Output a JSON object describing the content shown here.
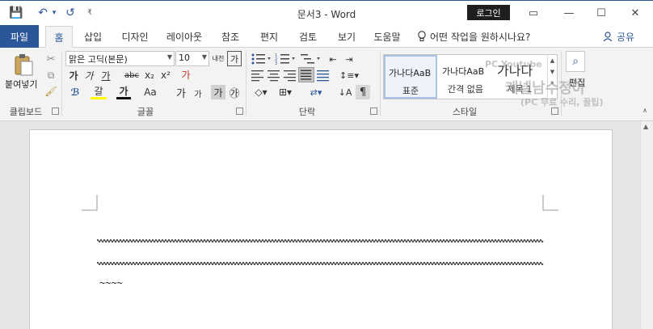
{
  "titlebar": {
    "title": "문서3 - Word",
    "login_label": "로그인",
    "save_icon": "💾",
    "undo_icon": "↶",
    "undo_dropdown": "▾",
    "redo_icon": "↺",
    "customize_icon": "₹",
    "ribbon_options_icon": "▭",
    "minimize_icon": "—",
    "maximize_icon": "☐",
    "close_icon": "✕"
  },
  "tabs": {
    "file": "파일",
    "items": [
      "홈",
      "삽입",
      "디자인",
      "레이아웃",
      "참조",
      "편지",
      "검토",
      "보기",
      "도움말"
    ],
    "tellme": "어떤 작업을 원하시나요?",
    "share": "공유"
  },
  "ribbon": {
    "clipboard": {
      "label": "클립보드",
      "paste": "붙여넣기"
    },
    "font": {
      "label": "글꼴",
      "font_name": "맑은 고딕(본문)",
      "font_size": "10",
      "bold": "가",
      "italic": "가",
      "underline": "가",
      "strike": "abc",
      "subscript": "x₂",
      "superscript": "x²",
      "clear": "가",
      "aa": "Aa",
      "grow": "가",
      "shrink": "가",
      "phonetic": "내천",
      "charborder": "가",
      "highlight": "갈",
      "fontcolor": "가",
      "charshade": "가",
      "enclose": "㉮"
    },
    "paragraph": {
      "label": "단락"
    },
    "styles": {
      "label": "스타일",
      "items": [
        {
          "sample": "가나다AaB",
          "name": "표준"
        },
        {
          "sample": "가나다AaB",
          "name": "간격 없음"
        },
        {
          "sample": "가나다",
          "name": "제목 1"
        }
      ]
    },
    "editing": {
      "label": "편집"
    },
    "watermark": {
      "line1": "PC Youtube",
      "line2": "케넬남수정아",
      "line3": "(PC 무료 수리, 꿀팁)"
    }
  },
  "document": {
    "tilde_text": "~~~~"
  }
}
